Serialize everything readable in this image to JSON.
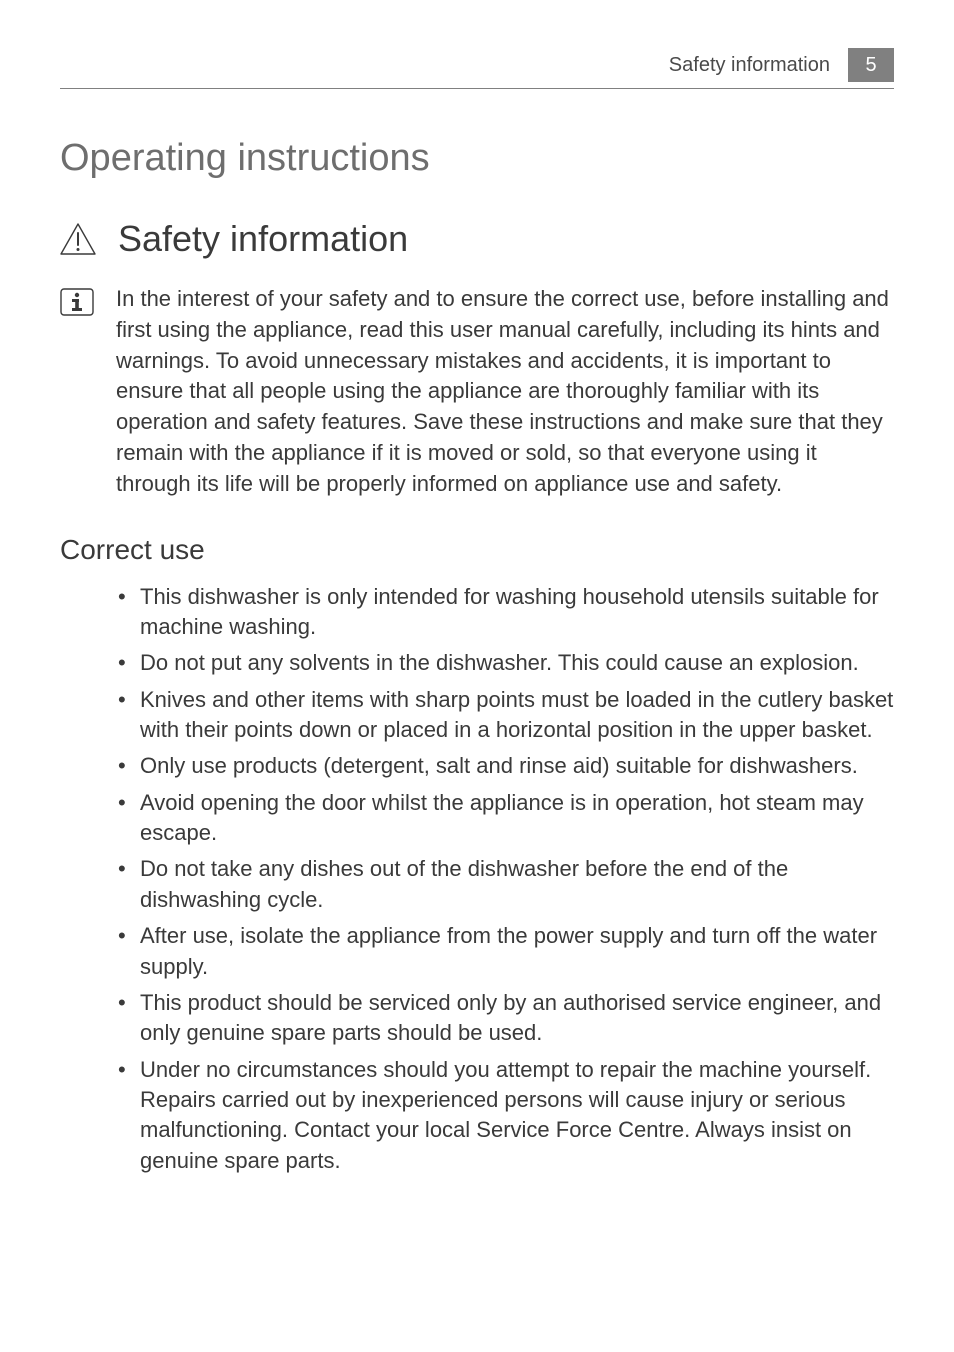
{
  "header": {
    "section_label": "Safety information",
    "page_number": "5"
  },
  "h1": "Operating instructions",
  "safety_heading": "Safety information",
  "info_paragraph": "In the interest of your safety and to ensure the correct use, before installing and first using the appliance, read this user manual carefully, including its hints and warnings. To avoid unnecessary mistakes and accidents, it is important to ensure that all people using the appliance are thoroughly familiar with its operation and safety features. Save these instructions and make sure that they remain with the appliance if it is moved or sold, so that everyone using it through its life will be properly informed on appliance use and safety.",
  "correct_use": {
    "heading": "Correct use",
    "items": [
      "This dishwasher is only intended for washing household utensils suitable for machine washing.",
      "Do not put any solvents in the dishwasher. This could cause an explosion.",
      "Knives and other items with sharp points must be loaded in the cutlery basket with their points down or placed in a horizontal position in the upper basket.",
      "Only use products (detergent, salt and rinse aid) suitable for dishwashers.",
      "Avoid opening the door whilst the appliance is in operation, hot steam may escape.",
      "Do not take any dishes out of the dishwasher before the end of the dishwashing cycle.",
      "After use, isolate the appliance from the power supply and turn off the water supply.",
      "This product should be serviced only by an authorised service engineer, and only genuine spare parts should be used.",
      "Under no circumstances should you attempt to repair the machine yourself. Repairs carried out by inexperienced persons will cause injury or serious malfunctioning. Contact your local Service Force Centre. Always insist on genuine spare parts."
    ]
  }
}
